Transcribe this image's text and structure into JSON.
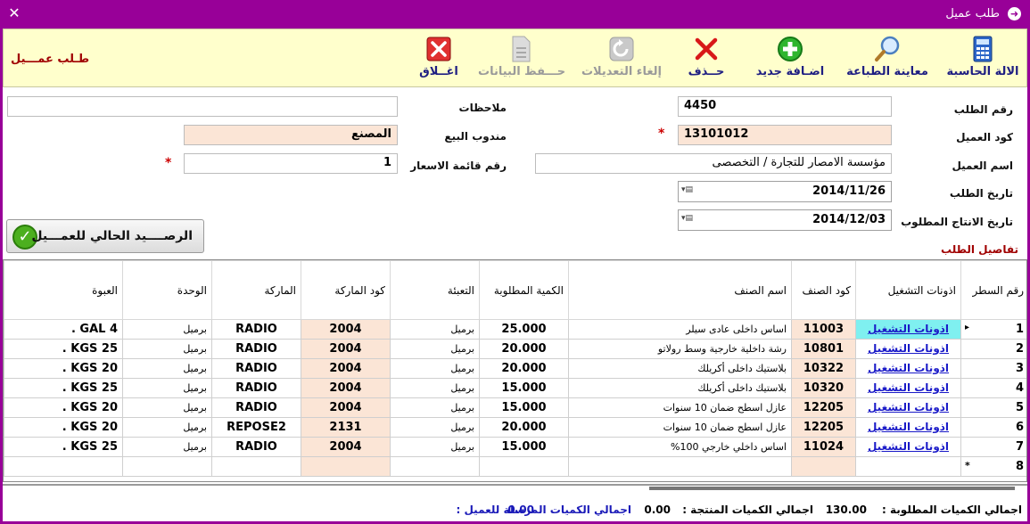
{
  "window": {
    "title": "طلب عميل",
    "close_icon": "✕"
  },
  "toolbar": {
    "calculator": "الالة الحاسبة",
    "print_preview": "معاينة الطباعة",
    "add_new": "اضـافة جديد",
    "delete": "حــذف",
    "cancel_edits": "إلغاء التعديلات",
    "save": "حـــفظ البيانات",
    "close": "اغــلاق"
  },
  "form_title": "طـلب عمـــيل",
  "fields": {
    "order_no_label": "رقم الطلب",
    "order_no": "4450",
    "customer_code_label": "كود العميل",
    "customer_code": "13101012",
    "customer_name_label": "اسم العميل",
    "customer_name": "مؤسسة الامصار للتجارة / التخصصى",
    "order_date_label": "تاريخ الطلب",
    "order_date": "2014/11/26",
    "production_date_label": "تاريخ الانتاج المطلوب",
    "production_date": "2014/12/03",
    "notes_label": "ملاحظات",
    "notes": "",
    "sales_rep_label": "مندوب البيع",
    "sales_rep": "المصنع",
    "price_list_label": "رقم قائمة الاسعار",
    "price_list": "1",
    "required_mark": "*"
  },
  "balance_button": "الرصــــيد الحالي للعمـــيل",
  "details_label": "تفاصيل الطلب",
  "grid": {
    "headers": [
      "رقم السطر",
      "اذونات التشغيل",
      "كود الصنف",
      "اسم الصنف",
      "الكمية المطلوبة",
      "التعبئة",
      "كود الماركة",
      "الماركة",
      "الوحدة",
      "العبوة"
    ],
    "rows": [
      {
        "line": "1",
        "op": "اذونات التشغيل",
        "code": "11003",
        "name": "اساس داخلى عادى سيلر",
        "qty": "25.000",
        "pack": "برميل",
        "brand_code": "2004",
        "brand": "RADIO",
        "unit": "برميل",
        "package": "GAL 4 ."
      },
      {
        "line": "2",
        "op": "اذونات التشغيل",
        "code": "10801",
        "name": "رشة داخلية خارجية وسط رولاتو",
        "qty": "20.000",
        "pack": "برميل",
        "brand_code": "2004",
        "brand": "RADIO",
        "unit": "برميل",
        "package": "KGS 25 ."
      },
      {
        "line": "3",
        "op": "اذونات التشغيل",
        "code": "10322",
        "name": "بلاستيك داخلى أكريلك",
        "qty": "20.000",
        "pack": "برميل",
        "brand_code": "2004",
        "brand": "RADIO",
        "unit": "برميل",
        "package": "KGS 20 ."
      },
      {
        "line": "4",
        "op": "اذونات التشغيل",
        "code": "10320",
        "name": "بلاستيك داخلى أكريلك",
        "qty": "15.000",
        "pack": "برميل",
        "brand_code": "2004",
        "brand": "RADIO",
        "unit": "برميل",
        "package": "KGS 25 ."
      },
      {
        "line": "5",
        "op": "اذونات التشغيل",
        "code": "12205",
        "name": "عازل اسطح ضمان 10 سنوات",
        "qty": "15.000",
        "pack": "برميل",
        "brand_code": "2004",
        "brand": "RADIO",
        "unit": "برميل",
        "package": "KGS 20 ."
      },
      {
        "line": "6",
        "op": "اذونات التشغيل",
        "code": "12205",
        "name": "عازل اسطح ضمان 10 سنوات",
        "qty": "20.000",
        "pack": "برميل",
        "brand_code": "2131",
        "brand": "REPOSE2",
        "unit": "برميل",
        "package": "KGS 20 ."
      },
      {
        "line": "7",
        "op": "اذونات التشغيل",
        "code": "11024",
        "name": "اساس داخلي خارجي 100%",
        "qty": "15.000",
        "pack": "برميل",
        "brand_code": "2004",
        "brand": "RADIO",
        "unit": "برميل",
        "package": "KGS 25 ."
      }
    ],
    "new_row": "8",
    "new_row_marker": "*",
    "current_row_marker": "▸"
  },
  "footer": {
    "total_required_label": "اجمالي الكميات المطلوبة :",
    "total_required": "130.00",
    "total_produced_label": "اجمالي الكميات المنتجة :",
    "total_produced": "0.00",
    "total_sent_label": "اجمالي الكميات المرسلة للعميل :",
    "total_sent": "0.00"
  }
}
